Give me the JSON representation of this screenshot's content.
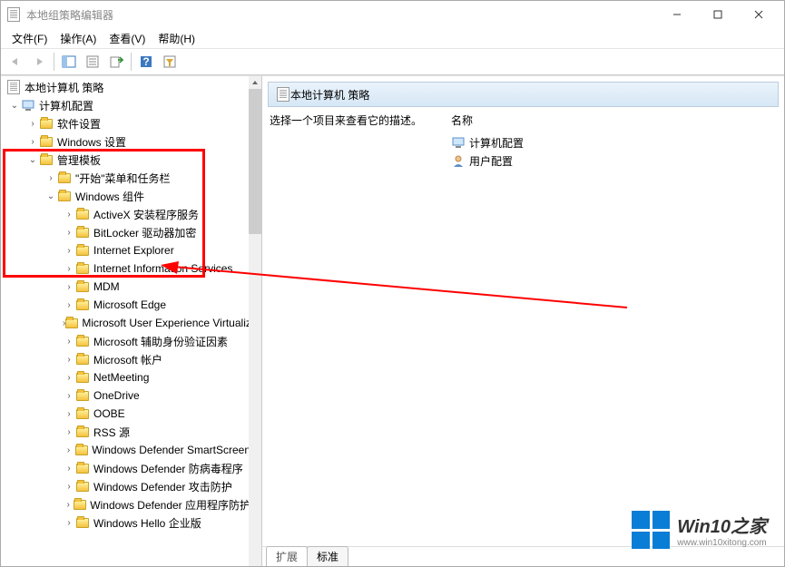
{
  "window": {
    "title": "本地组策略编辑器"
  },
  "menu": {
    "file": "文件(F)",
    "action": "操作(A)",
    "view": "查看(V)",
    "help": "帮助(H)"
  },
  "tree": {
    "root": "本地计算机 策略",
    "computer_config": "计算机配置",
    "software_settings": "软件设置",
    "windows_settings": "Windows 设置",
    "admin_templates": "管理模板",
    "start_menu_taskbar": "\"开始\"菜单和任务栏",
    "windows_components": "Windows 组件",
    "items": [
      "ActiveX 安装程序服务",
      "BitLocker 驱动器加密",
      "Internet Explorer",
      "Internet Information Services",
      "MDM",
      "Microsoft Edge",
      "Microsoft User Experience Virtualization",
      "Microsoft 辅助身份验证因素",
      "Microsoft 帐户",
      "NetMeeting",
      "OneDrive",
      "OOBE",
      "RSS 源",
      "Windows Defender SmartScreen",
      "Windows Defender 防病毒程序",
      "Windows Defender 攻击防护",
      "Windows Defender 应用程序防护",
      "Windows Hello 企业版"
    ]
  },
  "detail": {
    "header_title": "本地计算机 策略",
    "prompt": "选择一个项目来查看它的描述。",
    "column_name": "名称",
    "objects": [
      "计算机配置",
      "用户配置"
    ]
  },
  "tabs": {
    "extended": "扩展",
    "standard": "标准"
  },
  "watermark": {
    "brand": "Win10之家",
    "url": "www.win10xitong.com"
  }
}
